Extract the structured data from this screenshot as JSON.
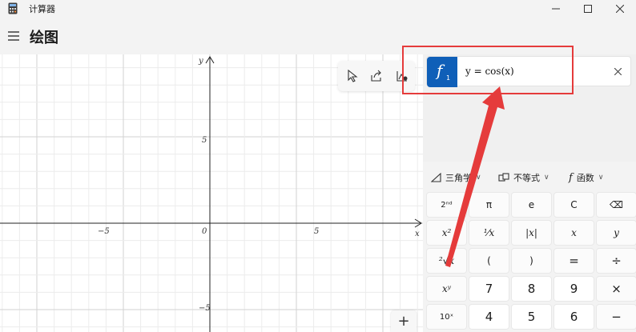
{
  "window": {
    "title": "计算器",
    "minimize_icon": "minimize-icon",
    "maximize_icon": "maximize-icon",
    "close_icon": "close-icon"
  },
  "header": {
    "menu_icon": "hamburger-icon",
    "title": "绘图"
  },
  "graph": {
    "x_axis_label": "x",
    "y_axis_label": "y",
    "x_ticks": [
      "−5",
      "0",
      "5"
    ],
    "y_ticks": [
      "5",
      "−5"
    ],
    "toolbar_icons": [
      "cursor-icon",
      "share-icon",
      "graph-settings-icon"
    ],
    "zoom_in_label": "+"
  },
  "functions": [
    {
      "badge_letter": "f",
      "badge_index": "1",
      "expression": "y = cos(x)",
      "color": "#0f5fb8"
    }
  ],
  "keyboard_tabs": [
    {
      "icon": "triangle-icon",
      "label": "三角学"
    },
    {
      "icon": "inequality-icon",
      "label": "不等式"
    },
    {
      "icon": "function-icon",
      "label": "函数"
    }
  ],
  "keys": {
    "second": "2ⁿᵈ",
    "pi": "π",
    "e": "e",
    "clear": "C",
    "backspace": "⌫",
    "x_squared": "x²",
    "reciprocal": "¹⁄x",
    "abs": "|x|",
    "x": "x",
    "y": "y",
    "root": "²√x",
    "lparen": "(",
    "rparen": ")",
    "equals": "=",
    "divide": "÷",
    "power": "xʸ",
    "seven": "7",
    "eight": "8",
    "nine": "9",
    "multiply": "×",
    "ten_power": "10ˣ",
    "four": "4",
    "five": "5",
    "six": "6",
    "minus": "−"
  },
  "colors": {
    "accent": "#0f5fb8",
    "annotation": "#e53b3b"
  }
}
